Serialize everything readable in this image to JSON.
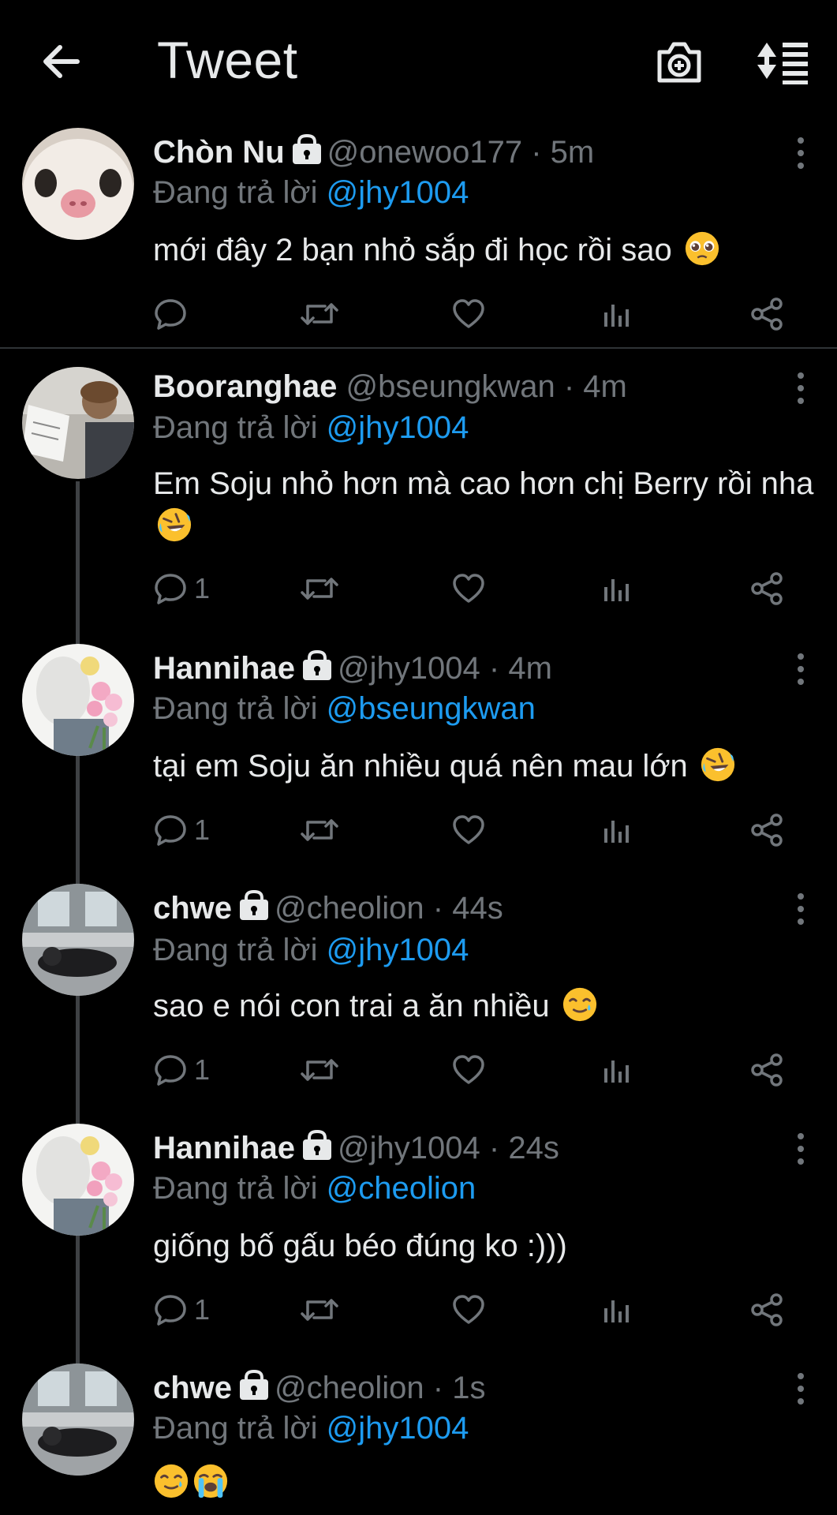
{
  "header": {
    "title": "Tweet",
    "back_icon": "arrow-left-icon",
    "camera_icon": "camera-add-icon",
    "sort_icon": "sort-icon"
  },
  "colors": {
    "background": "#000000",
    "text": "#e7e9ea",
    "secondary": "#71767b",
    "accent": "#1d9bf0"
  },
  "reply_prefix": "Đang trả lời",
  "tweets": [
    {
      "name": "Chòn Nu",
      "locked": true,
      "handle": "@onewoo177",
      "time": "· 5m",
      "replying_to": "@jhy1004",
      "text": "mới đây 2 bạn nhỏ sắp đi học rồi sao",
      "emoji": "pleading-face",
      "reply_count": "",
      "avatar": "cat-avatar"
    },
    {
      "name": "Booranghae",
      "locked": false,
      "handle": "@bseungkwan",
      "time": "· 4m",
      "replying_to": "@jhy1004",
      "text": "Em Soju nhỏ hơn mà cao hơn chị Berry rồi nha",
      "emoji": "rolling-laughing-face",
      "reply_count": "1",
      "avatar": "person-reading-avatar"
    },
    {
      "name": "Hannihae",
      "locked": true,
      "handle": "@jhy1004",
      "time": "· 4m",
      "replying_to": "@bseungkwan",
      "text": "tại em Soju ăn nhiều quá nên mau lớn",
      "emoji": "rolling-laughing-face",
      "reply_count": "1",
      "avatar": "flowers-avatar"
    },
    {
      "name": "chwe",
      "locked": true,
      "handle": "@cheolion",
      "time": "· 44s",
      "replying_to": "@jhy1004",
      "text": "sao e nói con trai a ăn nhiều",
      "emoji": "smiling-tear-face",
      "reply_count": "1",
      "avatar": "room-avatar"
    },
    {
      "name": "Hannihae",
      "locked": true,
      "handle": "@jhy1004",
      "time": "· 24s",
      "replying_to": "@cheolion",
      "text": "giống bố gấu béo đúng ko :)))",
      "emoji": "",
      "reply_count": "1",
      "avatar": "flowers-avatar"
    },
    {
      "name": "chwe",
      "locked": true,
      "handle": "@cheolion",
      "time": "· 1s",
      "replying_to": "@jhy1004",
      "text": "",
      "emoji": "smiling-tear-face loudly-crying-face",
      "reply_count": "",
      "avatar": "room-avatar"
    }
  ]
}
